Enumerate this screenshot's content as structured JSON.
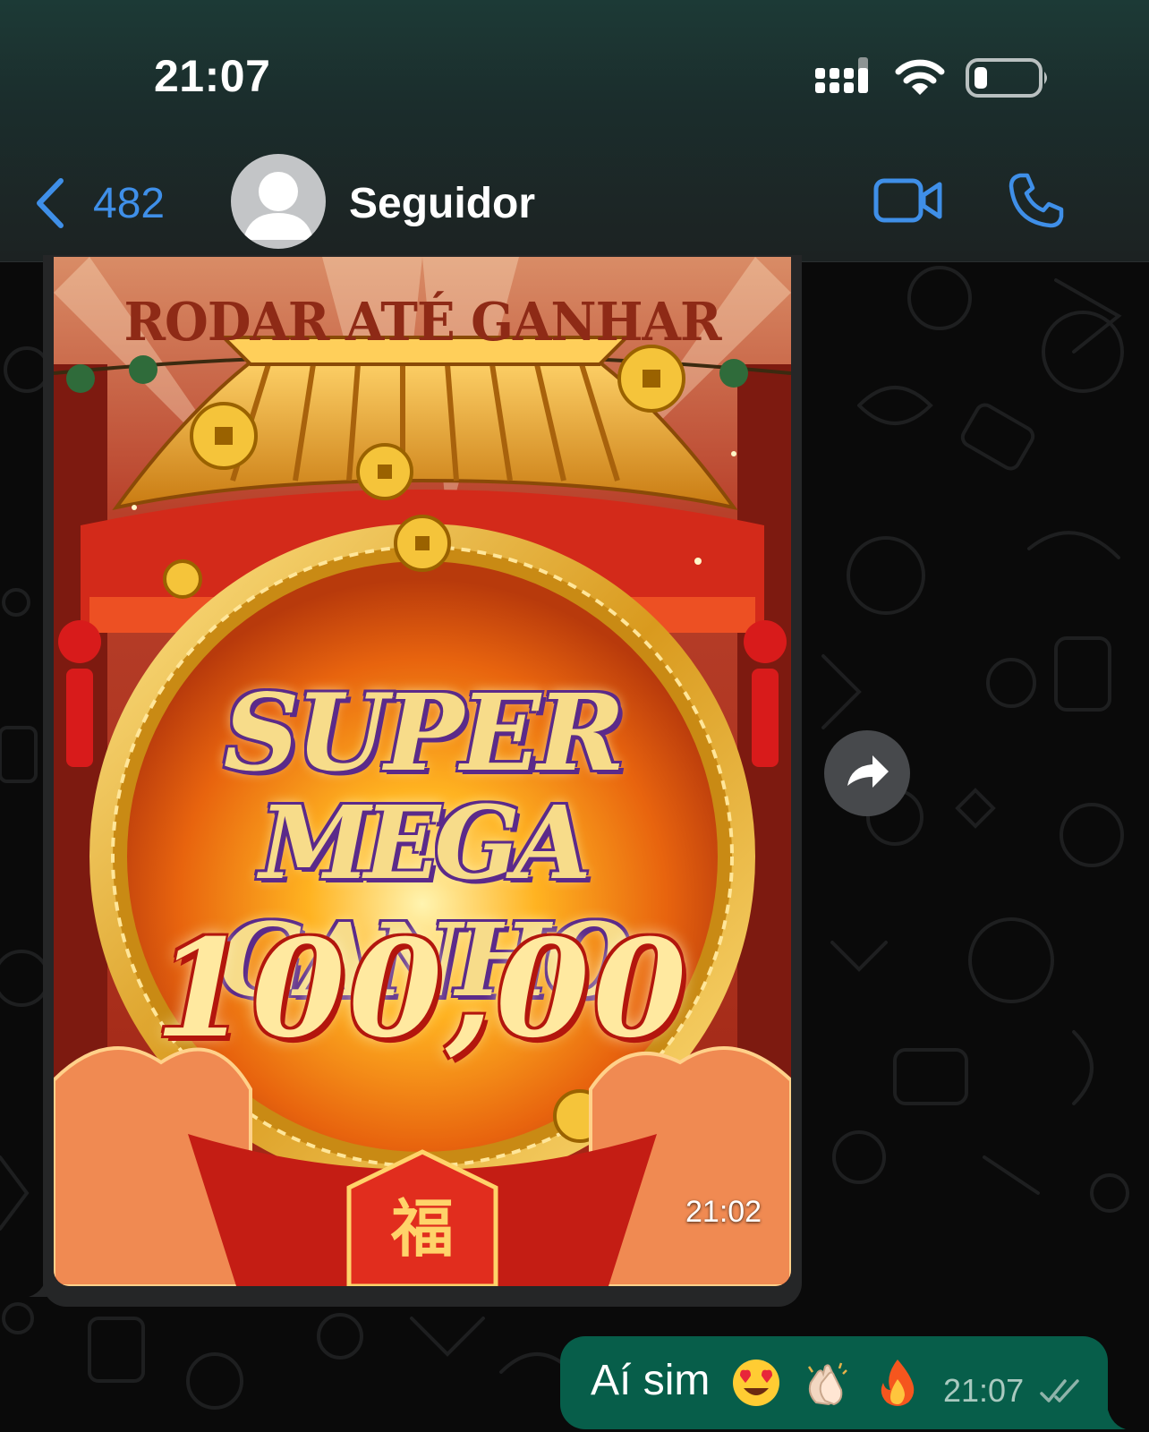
{
  "status_bar": {
    "time": "21:07"
  },
  "header": {
    "back_count": "482",
    "contact_name": "Seguidor"
  },
  "messages": {
    "incoming_image": {
      "banner": "RODAR ATÉ GANHAR",
      "line1": "SUPER",
      "line2": "MEGA GANHO",
      "amount": "100,00",
      "time": "21:02"
    },
    "outgoing": {
      "text": "Aí sim",
      "emojis": [
        "heart-eyes-emoji",
        "clapping-hands-emoji",
        "fire-emoji"
      ],
      "time": "21:07",
      "status": "read"
    }
  },
  "colors": {
    "accent_blue": "#3f8fe8",
    "outgoing_bubble": "#075e4a",
    "incoming_bubble": "#252627"
  }
}
